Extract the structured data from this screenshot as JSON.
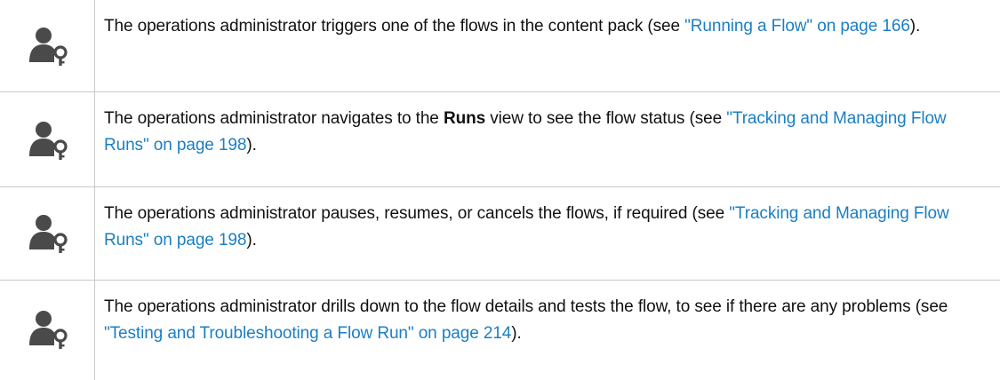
{
  "colors": {
    "link": "#1b7fc2",
    "text": "#111111",
    "divider": "#c9c9c9",
    "icon": "#4a4a4a"
  },
  "steps": [
    {
      "icon": "admin-user-key-icon",
      "before": "The operations administrator triggers one of the flows in the content pack (see ",
      "link": "\"Running a Flow\" on page 166",
      "after": ")."
    },
    {
      "icon": "admin-user-key-icon",
      "before": "The operations administrator navigates to the ",
      "bold": "Runs",
      "middle": " view to see the flow status (see ",
      "link": "\"Tracking and Managing Flow Runs\" on page 198",
      "after": ")."
    },
    {
      "icon": "admin-user-key-icon",
      "before": "The operations administrator pauses, resumes, or cancels the flows, if required (see ",
      "link": "\"Tracking and Managing Flow Runs\" on page 198",
      "after": ")."
    },
    {
      "icon": "admin-user-key-icon",
      "before": "The operations administrator drills down to the flow details and tests the flow, to see if there are any problems (see ",
      "link": "\"Testing and Troubleshooting a Flow Run\" on page 214",
      "after": ")."
    }
  ]
}
